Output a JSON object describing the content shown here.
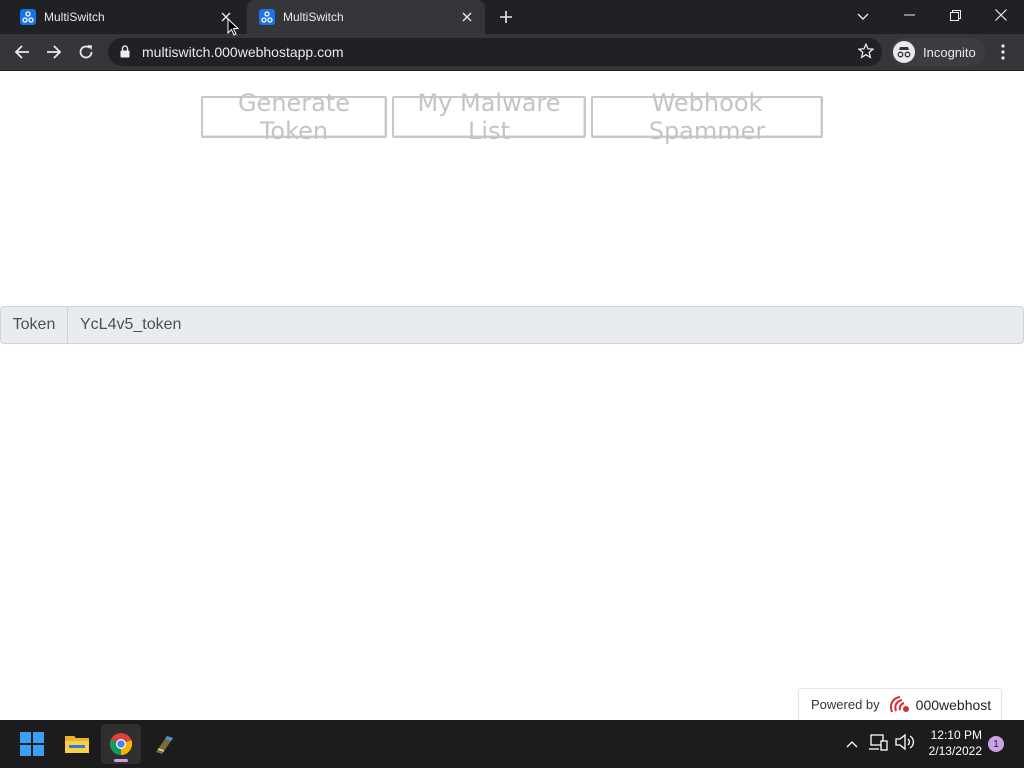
{
  "browser": {
    "tabs": [
      {
        "title": "MultiSwitch",
        "active": false
      },
      {
        "title": "MultiSwitch",
        "active": true
      }
    ],
    "url": "multiswitch.000webhostapp.com",
    "incognito_label": "Incognito"
  },
  "page": {
    "buttons": {
      "generate_token": "Generate Token",
      "malware_list": "My Malware List",
      "webhook_spammer": "Webhook Spammer"
    },
    "token": {
      "label": "Token",
      "value": "YcL4v5_token"
    },
    "footer": {
      "powered_by": "Powered by",
      "brand": "000webhost"
    }
  },
  "taskbar": {
    "time": "12:10 PM",
    "date": "2/13/2022",
    "notification_count": "1"
  },
  "colors": {
    "tab_strip": "#202124",
    "toolbar": "#35363a",
    "page_button_text": "#c4c4c4",
    "input_group_bg": "#e9ecef",
    "taskbar": "#1c1c1c"
  }
}
